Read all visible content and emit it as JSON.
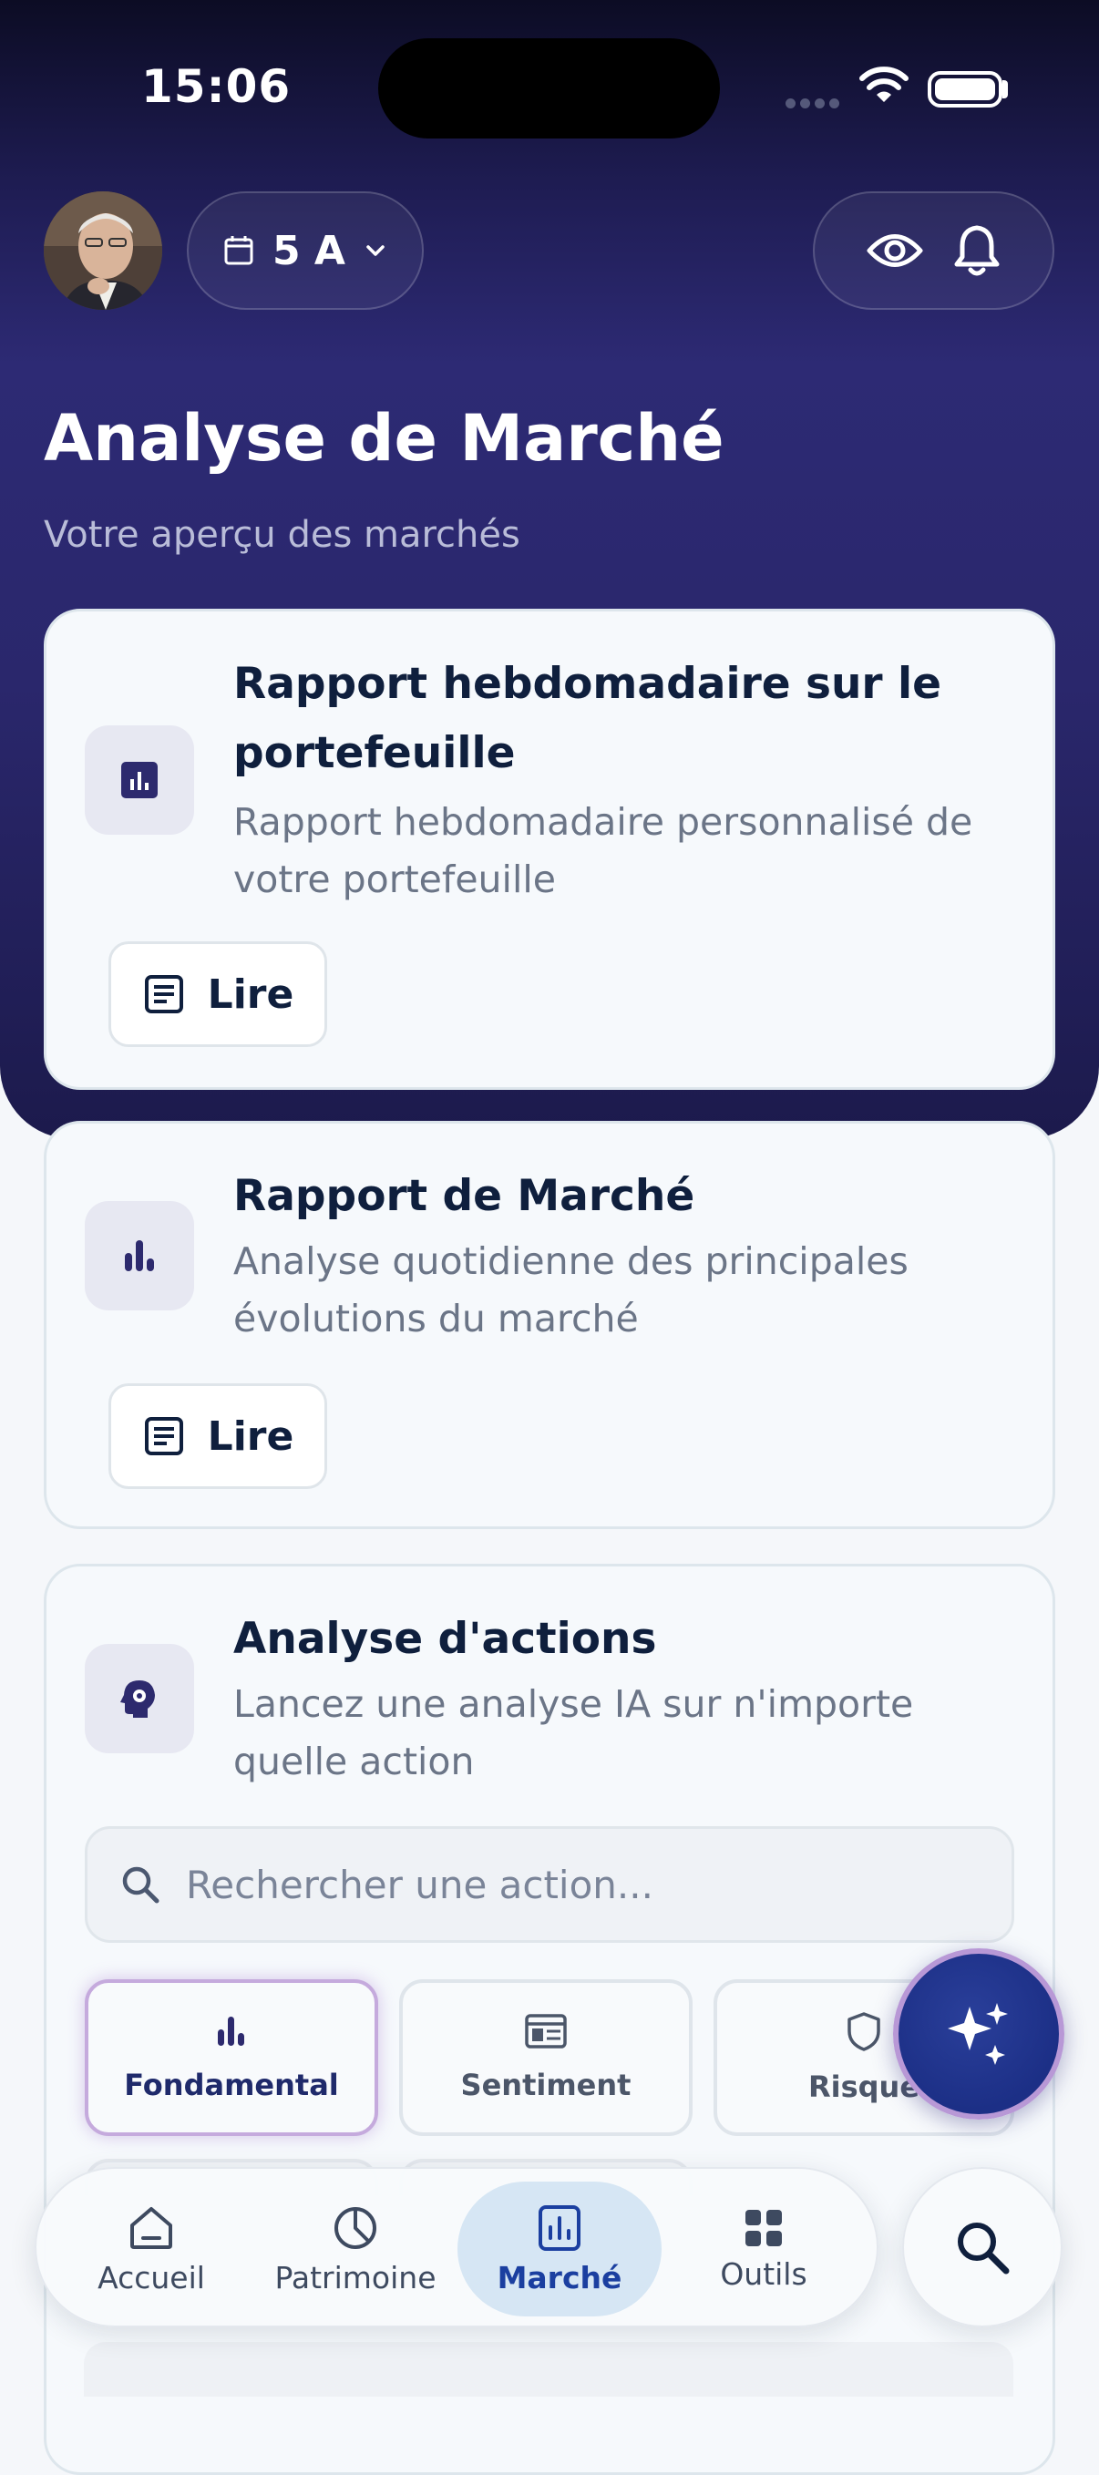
{
  "status_bar": {
    "time": "15:06"
  },
  "header": {
    "period_label": "5 A",
    "title": "Analyse de Marché",
    "subtitle": "Votre aperçu des marchés"
  },
  "cards": [
    {
      "title": "Rapport hebdomadaire sur le portefeuille",
      "description": "Rapport hebdomadaire personnalisé de votre portefeuille",
      "button_label": "Lire",
      "icon": "bar-chart-box-icon"
    },
    {
      "title": "Rapport de Marché",
      "description": "Analyse quotidienne des principales évolutions du marché",
      "button_label": "Lire",
      "icon": "bar-chart-icon"
    },
    {
      "title": "Analyse d'actions",
      "description": "Lancez une analyse IA sur n'importe quelle action",
      "search_placeholder": "Rechercher une action...",
      "icon": "brain-gear-icon",
      "analysis_types": [
        {
          "label": "Fondamental",
          "icon": "bar-chart-icon",
          "active": true
        },
        {
          "label": "Sentiment",
          "icon": "newspaper-icon",
          "active": false
        },
        {
          "label": "Risque",
          "icon": "shield-icon",
          "active": false
        }
      ]
    }
  ],
  "bottom_nav": {
    "items": [
      {
        "label": "Accueil",
        "icon": "home-icon"
      },
      {
        "label": "Patrimoine",
        "icon": "pie-chart-icon"
      },
      {
        "label": "Marché",
        "icon": "chart-icon",
        "active": true
      },
      {
        "label": "Outils",
        "icon": "grid-icon"
      }
    ],
    "search_icon": "search-icon"
  },
  "fab": {
    "icon": "sparkles-icon"
  },
  "colors": {
    "hero_top": "#0c0c24",
    "hero_bottom": "#2d2a74",
    "accent": "#1b3fa0",
    "text_dark": "#0f1f3d",
    "text_muted": "#6b7587"
  }
}
